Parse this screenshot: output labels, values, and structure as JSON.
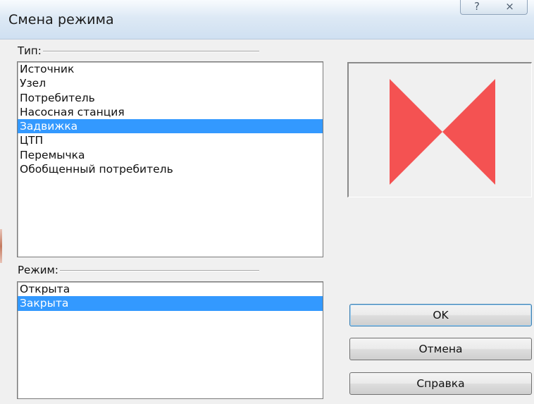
{
  "window": {
    "title": "Смена режима",
    "help_glyph": "?",
    "close_glyph": "⨯"
  },
  "type_group": {
    "label": "Тип:",
    "items": [
      "Источник",
      "Узел",
      "Потребитель",
      "Насосная станция",
      "Задвижка",
      "ЦТП",
      "Перемычка",
      "Обобщенный потребитель"
    ],
    "selected_item": "Задвижка"
  },
  "mode_group": {
    "label": "Режим:",
    "items": [
      "Открыта",
      "Закрыта"
    ],
    "selected_item": "Закрыта"
  },
  "preview": {
    "icon": "valve-closed-icon",
    "color": "#f45252"
  },
  "buttons": {
    "ok": "OK",
    "cancel": "Отмена",
    "help": "Справка"
  },
  "colors": {
    "selection": "#3399ff",
    "titlebar": "#dde9f5"
  }
}
